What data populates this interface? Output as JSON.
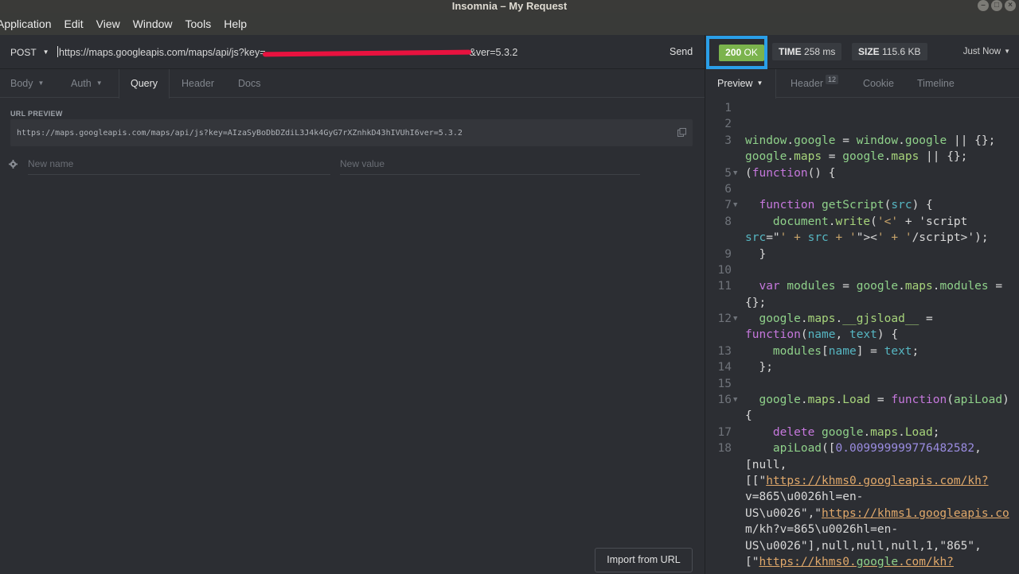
{
  "window": {
    "title": "Insomnia – My Request"
  },
  "menubar": {
    "items": [
      "Application",
      "Edit",
      "View",
      "Window",
      "Tools",
      "Help"
    ]
  },
  "request": {
    "method": "POST",
    "url_prefix": "https://maps.googleapis.com/maps/api/js?key=",
    "url_suffix": "&ver=5.3.2",
    "send_label": "Send"
  },
  "request_tabs": [
    "Body",
    "Auth",
    "Query",
    "Header",
    "Docs"
  ],
  "url_preview": {
    "label": "URL PREVIEW",
    "value": "https://maps.googleapis.com/maps/api/js?key=AIzaSyBoDbDZdiL3J4k4GyG7rXZnhkD43hIVUhI6ver=5.3.2"
  },
  "query_params": {
    "name_placeholder": "New name",
    "value_placeholder": "New value"
  },
  "import_button": "Import from URL",
  "response": {
    "status_code": "200",
    "status_text": "OK",
    "time_label": "TIME",
    "time_value": "258 ms",
    "size_label": "SIZE",
    "size_value": "115.6 KB",
    "when": "Just Now",
    "status_color": "#7bb34d",
    "highlight_color": "#2a9fe8"
  },
  "response_tabs": {
    "preview": "Preview",
    "header": "Header",
    "header_count": "12",
    "cookie": "Cookie",
    "timeline": "Timeline"
  },
  "code_lines": [
    {
      "n": "1",
      "t": ""
    },
    {
      "n": "2",
      "t": ""
    },
    {
      "n": "3",
      "t": "window.google = window.google || {};"
    },
    {
      "n": "",
      "t": "google.maps = google.maps || {};"
    },
    {
      "n": "5",
      "t": "(function() {"
    },
    {
      "n": "6",
      "t": ""
    },
    {
      "n": "7",
      "t": "  function getScript(src) {"
    },
    {
      "n": "8",
      "t": "    document.write('<' + 'script"
    },
    {
      "n": "",
      "t": "src=\"' + src + '\"><' + '/script>');"
    },
    {
      "n": "9",
      "t": "  }"
    },
    {
      "n": "10",
      "t": ""
    },
    {
      "n": "11",
      "t": "  var modules = google.maps.modules ="
    },
    {
      "n": "",
      "t": "{};"
    },
    {
      "n": "12",
      "t": "  google.maps.__gjsload__ ="
    },
    {
      "n": "",
      "t": "function(name, text) {"
    },
    {
      "n": "13",
      "t": "    modules[name] = text;"
    },
    {
      "n": "14",
      "t": "  };"
    },
    {
      "n": "15",
      "t": ""
    },
    {
      "n": "16",
      "t": "  google.maps.Load = function(apiLoad)"
    },
    {
      "n": "",
      "t": "{"
    },
    {
      "n": "17",
      "t": "    delete google.maps.Load;"
    },
    {
      "n": "18",
      "t": "    apiLoad([0.009999999776482582,"
    },
    {
      "n": "",
      "t": "[null,"
    },
    {
      "n": "",
      "t": "[[\"https://khms0.googleapis.com/kh?"
    },
    {
      "n": "",
      "t": "v=865\\u0026hl=en-"
    },
    {
      "n": "",
      "t": "US\\u0026\",\"https://khms1.googleapis.co"
    },
    {
      "n": "",
      "t": "m/kh?v=865\\u0026hl=en-"
    },
    {
      "n": "",
      "t": "US\\u0026\"],null,null,null,1,\"865\","
    },
    {
      "n": "",
      "t": "[\"https://khms0.google.com/kh?"
    }
  ]
}
